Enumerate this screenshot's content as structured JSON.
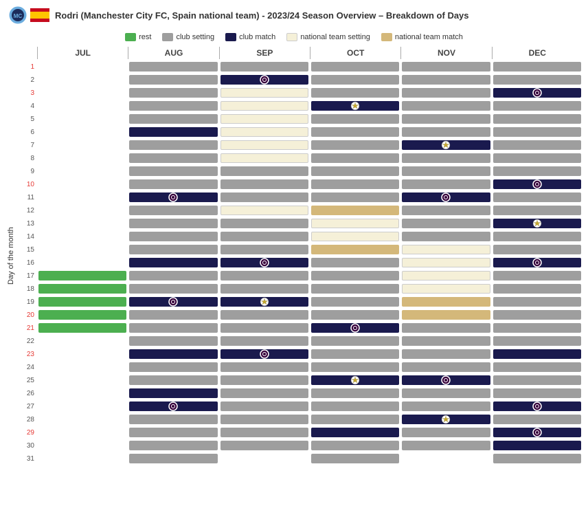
{
  "header": {
    "title": "Rodri (Manchester City FC, Spain national team) - 2023/24 Season Overview – Breakdown of Days"
  },
  "legend": {
    "items": [
      {
        "id": "rest",
        "label": "rest",
        "color": "#4caf50"
      },
      {
        "id": "club_setting",
        "label": "club setting",
        "color": "#9e9e9e"
      },
      {
        "id": "club_match",
        "label": "club match",
        "color": "#1a1a4e"
      },
      {
        "id": "nat_setting",
        "label": "national team setting",
        "color": "#f5f0d8"
      },
      {
        "id": "nat_match",
        "label": "national team match",
        "color": "#d4b87a"
      }
    ]
  },
  "months": [
    "JUL",
    "AUG",
    "SEP",
    "OCT",
    "NOV",
    "DEC"
  ],
  "yAxisLabel": "Day of the month",
  "days": [
    1,
    2,
    3,
    4,
    5,
    6,
    7,
    8,
    9,
    10,
    11,
    12,
    13,
    14,
    15,
    16,
    17,
    18,
    19,
    20,
    21,
    22,
    23,
    24,
    25,
    26,
    27,
    28,
    29,
    30,
    31
  ],
  "highlightDays": [
    1,
    3,
    10,
    20,
    21,
    23,
    29
  ]
}
